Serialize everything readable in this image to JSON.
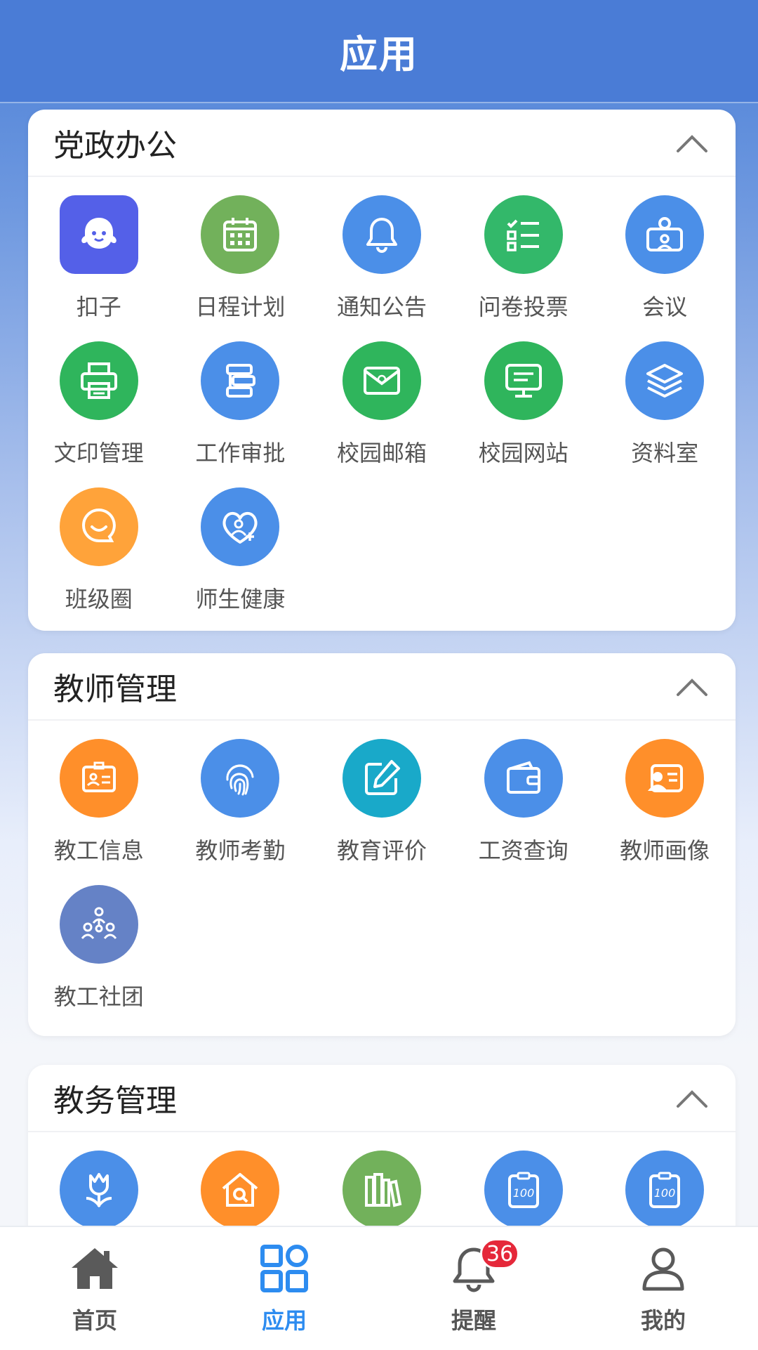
{
  "header": {
    "title": "应用"
  },
  "sections": [
    {
      "title": "党政办公",
      "apps": [
        {
          "label": "扣子",
          "icon": "ghost-icon",
          "color": "#5460e8"
        },
        {
          "label": "日程计划",
          "icon": "calendar-icon",
          "color": "#72b15b"
        },
        {
          "label": "通知公告",
          "icon": "bell-icon",
          "color": "#4b8fe8"
        },
        {
          "label": "问卷投票",
          "icon": "checklist-icon",
          "color": "#33b86a"
        },
        {
          "label": "会议",
          "icon": "meeting-icon",
          "color": "#4b8fe8"
        },
        {
          "label": "文印管理",
          "icon": "printer-icon",
          "color": "#2fb55c"
        },
        {
          "label": "工作审批",
          "icon": "approval-icon",
          "color": "#4b8fe8"
        },
        {
          "label": "校园邮箱",
          "icon": "mail-icon",
          "color": "#2fb55c"
        },
        {
          "label": "校园网站",
          "icon": "monitor-icon",
          "color": "#2fb55c"
        },
        {
          "label": "资料室",
          "icon": "layers-icon",
          "color": "#4b8fe8"
        },
        {
          "label": "班级圈",
          "icon": "chat-smile-icon",
          "color": "#ffa33a"
        },
        {
          "label": "师生健康",
          "icon": "health-icon",
          "color": "#4b8fe8"
        }
      ]
    },
    {
      "title": "教师管理",
      "apps": [
        {
          "label": "教工信息",
          "icon": "id-card-icon",
          "color": "#ff8f2a"
        },
        {
          "label": "教师考勤",
          "icon": "fingerprint-icon",
          "color": "#4b8fe8"
        },
        {
          "label": "教育评价",
          "icon": "edit-icon",
          "color": "#19a9c9"
        },
        {
          "label": "工资查询",
          "icon": "wallet-icon",
          "color": "#4b8fe8"
        },
        {
          "label": "教师画像",
          "icon": "profile-card-icon",
          "color": "#ff8f2a"
        },
        {
          "label": "教工社团",
          "icon": "group-icon",
          "color": "#6582c6"
        }
      ]
    },
    {
      "title": "教务管理",
      "apps": [
        {
          "label": "",
          "icon": "tulip-icon",
          "color": "#4b8fe8"
        },
        {
          "label": "",
          "icon": "house-search-icon",
          "color": "#ff8f2a"
        },
        {
          "label": "",
          "icon": "books-icon",
          "color": "#72b15b"
        },
        {
          "label": "",
          "icon": "score-100-icon",
          "color": "#4b8fe8"
        },
        {
          "label": "",
          "icon": "score-100-icon",
          "color": "#4b8fe8"
        }
      ]
    }
  ],
  "tabbar": {
    "items": [
      {
        "label": "首页",
        "icon": "home-icon"
      },
      {
        "label": "应用",
        "icon": "apps-grid-icon",
        "active": true
      },
      {
        "label": "提醒",
        "icon": "bell-outline-icon",
        "badge": "36"
      },
      {
        "label": "我的",
        "icon": "user-icon"
      }
    ]
  },
  "colors": {
    "header": "#4a7cd6",
    "active_tab": "#2d8cf0",
    "badge": "#e5283a"
  }
}
